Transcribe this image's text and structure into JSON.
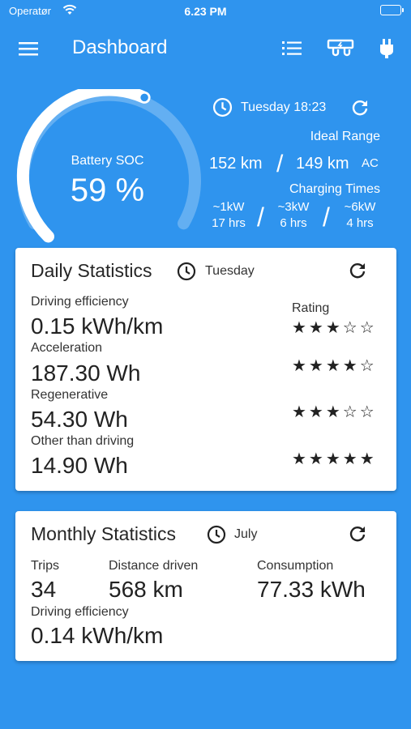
{
  "status_bar": {
    "carrier": "Operatør",
    "time": "6.23 PM"
  },
  "app_bar": {
    "title": "Dashboard",
    "icons": [
      "menu-icon",
      "list-icon",
      "charger-icon",
      "plug-icon"
    ]
  },
  "header": {
    "battery_label": "Battery SOC",
    "battery_value": "59 %",
    "battery_level": 0.59,
    "day_time": "Tuesday 18:23",
    "ideal_range_label": "Ideal Range",
    "range_1": "152 km",
    "range_2": "149 km",
    "range_unit": "AC",
    "charging_label": "Charging Times",
    "charging": [
      {
        "power": "~1kW",
        "time": "17 hrs"
      },
      {
        "power": "~3kW",
        "time": "6 hrs"
      },
      {
        "power": "~6kW",
        "time": "4 hrs"
      }
    ]
  },
  "daily": {
    "title": "Daily Statistics",
    "day": "Tuesday",
    "rating_label": "Rating",
    "rows": [
      {
        "label": "Driving efficiency",
        "value": "0.15 kWh/km",
        "stars": "★★★☆☆",
        "rating": 3
      },
      {
        "label": "Acceleration",
        "value": "187.30 Wh",
        "stars": "★★★★☆",
        "rating": 4
      },
      {
        "label": "Regenerative",
        "value": "54.30 Wh",
        "stars": "★★★☆☆",
        "rating": 3
      },
      {
        "label": "Other than driving",
        "value": "14.90 Wh",
        "stars": "★★★★★",
        "rating": 5
      }
    ]
  },
  "monthly": {
    "title": "Monthly Statistics",
    "month": "July",
    "trips_label": "Trips",
    "trips_value": "34",
    "distance_label": "Distance driven",
    "distance_value": "568 km",
    "consumption_label": "Consumption",
    "consumption_value": "77.33 kWh",
    "efficiency_label": "Driving efficiency",
    "efficiency_value": "0.14 kWh/km"
  },
  "colors": {
    "background": "#2f94ee",
    "card": "#ffffff",
    "text_dark": "#222222"
  }
}
